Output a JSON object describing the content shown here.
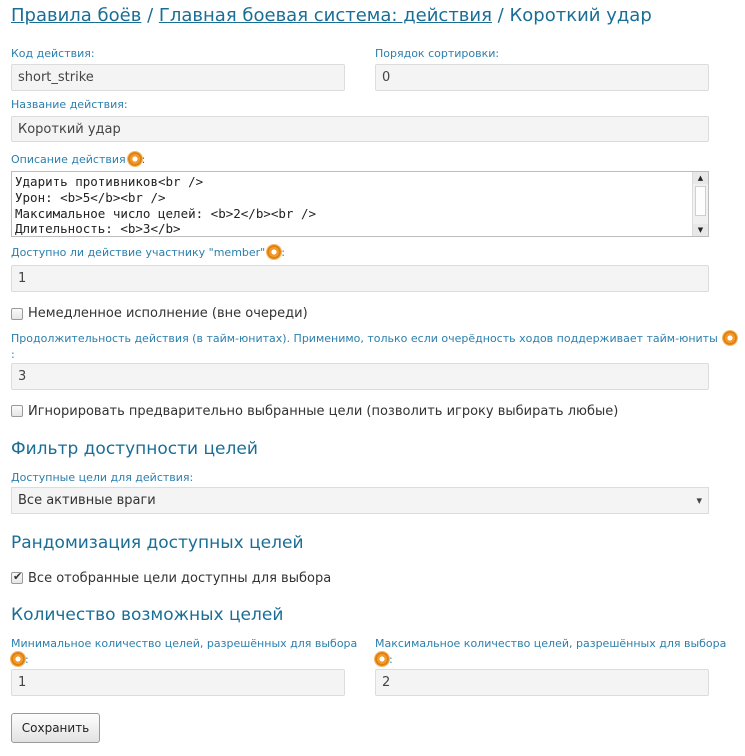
{
  "breadcrumb": {
    "items": [
      "Правила боёв",
      "Главная боевая система: действия",
      "Короткий удар"
    ],
    "separator": "/"
  },
  "fields": {
    "action_code": {
      "label": "Код действия:",
      "value": "short_strike"
    },
    "sort_order": {
      "label": "Порядок сортировки:",
      "value": "0"
    },
    "action_name": {
      "label": "Название действия:",
      "value": "Короткий удар"
    },
    "description": {
      "label": "Описание действия",
      "colon": ":",
      "value": "Ударить противников<br />\nУрон: <b>5</b><br />\nМаксимальное число целей: <b>2</b><br />\nДлительность: <b>3</b>"
    },
    "member_available": {
      "label": "Доступно ли действие участнику \"member\"",
      "colon": ":",
      "value": "1"
    },
    "immediate": {
      "label": "Немедленное исполнение (вне очереди)",
      "checked": false
    },
    "duration": {
      "label": "Продолжительность действия (в тайм-юнитах). Применимо, только если очерёдность ходов поддерживает тайм-юниты",
      "colon": ":",
      "value": "3"
    },
    "ignore_targets": {
      "label": "Игнорировать предварительно выбранные цели (позволить игроку выбирать любые)",
      "checked": false
    }
  },
  "sections": {
    "target_filter": {
      "title": "Фильтр доступности целей",
      "select_label": "Доступные цели для действия:",
      "select_value": "Все активные враги"
    },
    "randomization": {
      "title": "Рандомизация доступных целей",
      "checkbox_label": "Все отобранные цели доступны для выбора",
      "checked": true
    },
    "target_count": {
      "title": "Количество возможных целей",
      "min": {
        "label": "Минимальное количество целей, разрешённых для выбора",
        "colon": ":",
        "value": "1"
      },
      "max": {
        "label": "Максимальное количество целей, разрешённых для выбора",
        "colon": ":",
        "value": "2"
      }
    }
  },
  "save_button": "Сохранить",
  "colors": {
    "accent": "#1a6e96",
    "label": "#2b7fad",
    "icon": "#f29a2a"
  }
}
